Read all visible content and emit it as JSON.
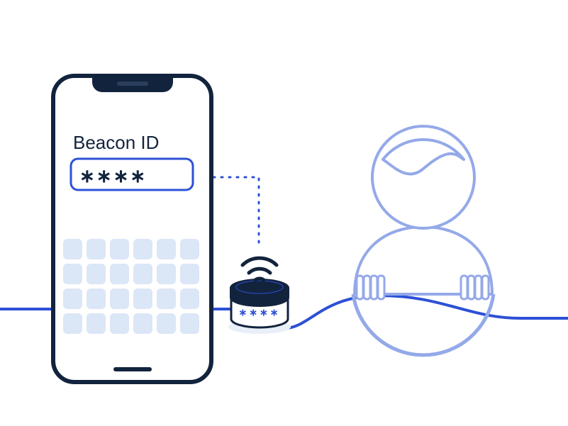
{
  "colors": {
    "darkNavy": "#12233d",
    "royalBlue": "#2d50d6",
    "paleBlue": "#dbe6f7",
    "lightBlueStroke": "#94a9e8",
    "shadow": "#e9eff9",
    "white": "#ffffff"
  },
  "phone": {
    "input_label": "Beacon ID",
    "input_value": "∗∗∗∗"
  },
  "beacon": {
    "display_value": "∗∗∗∗"
  }
}
